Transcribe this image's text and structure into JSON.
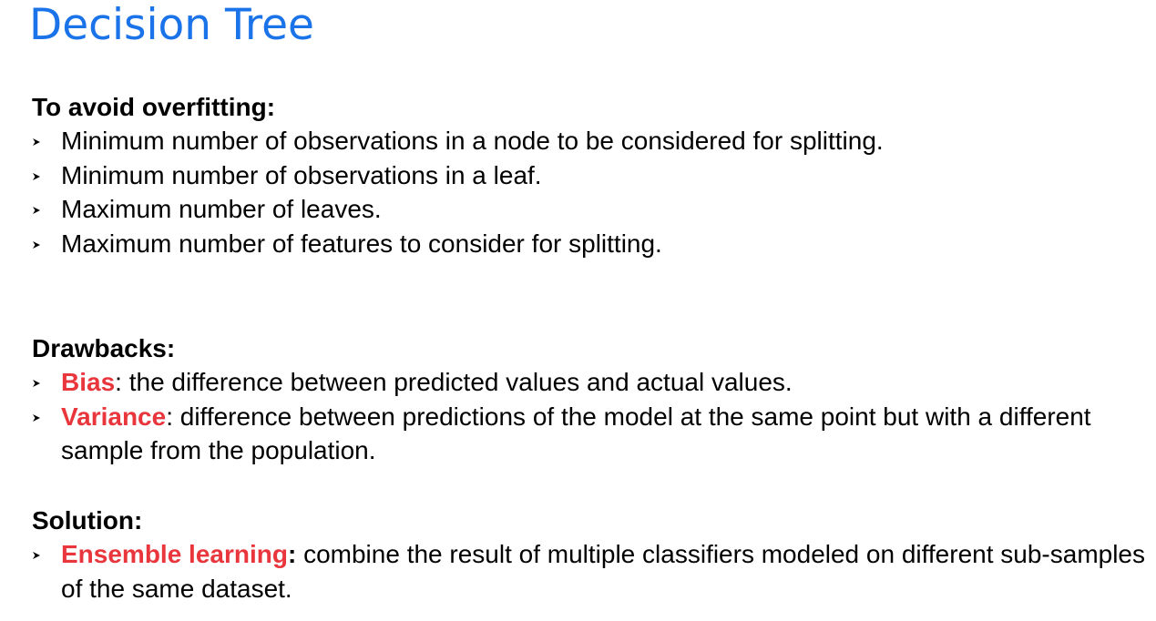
{
  "title": "Decision Tree",
  "overfitting": {
    "heading": "To avoid overfitting:",
    "items": [
      "Minimum number of observations in a node to be considered for splitting.",
      "Minimum number of observations in a leaf.",
      "Maximum number of leaves.",
      "Maximum number of features to consider for splitting."
    ]
  },
  "drawbacks": {
    "heading": "Drawbacks:",
    "items": [
      {
        "term": "Bias",
        "sep": ":",
        "text": " the difference between predicted values and actual values."
      },
      {
        "term": "Variance",
        "sep": ":",
        "text": " difference between predictions of the model at the same point but with a different sample from the population."
      }
    ]
  },
  "solution": {
    "heading": "Solution:",
    "items": [
      {
        "term": "Ensemble learning",
        "sep": ":",
        "text": " combine the result of multiple classifiers modeled on different sub-samples of the same dataset."
      }
    ]
  },
  "colors": {
    "title": "#1a73e8",
    "term": "#e8363c",
    "text": "#000000"
  },
  "bullet_icon": "arrowhead-bullet-icon"
}
